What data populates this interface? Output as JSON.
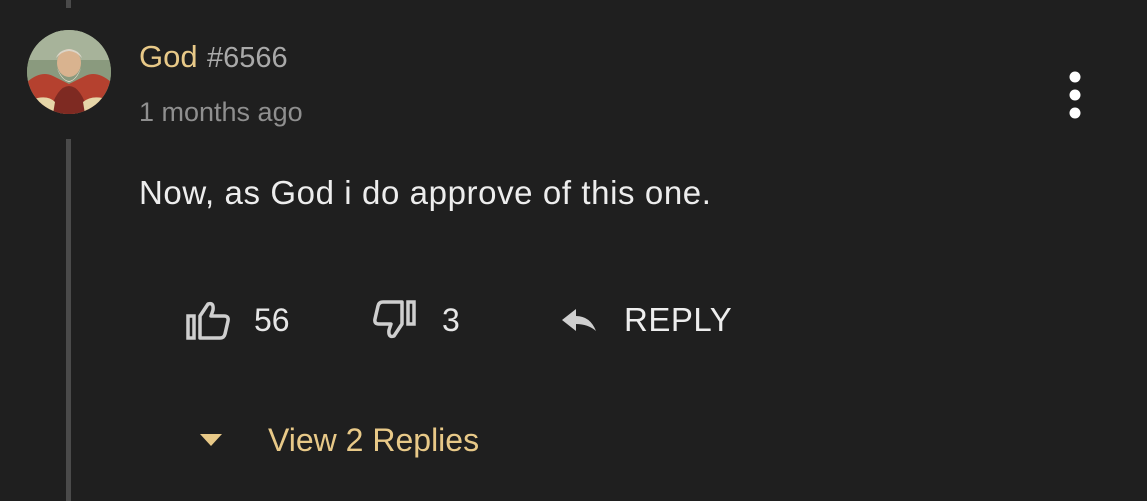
{
  "comment": {
    "author": {
      "name": "God",
      "tag": "#6566"
    },
    "timestamp": "1 months ago",
    "text": "Now, as God i do approve of this one.",
    "likes": "56",
    "dislikes": "3",
    "reply_label": "REPLY",
    "view_replies_label": "View 2 Replies"
  },
  "colors": {
    "background": "#1f1f1f",
    "accent": "#e8c988",
    "text": "#ededed",
    "muted": "#8f8f8f",
    "thread_line": "#4a4a4a"
  },
  "icons": {
    "more": "vertical-dots-icon",
    "like": "thumbs-up-icon",
    "dislike": "thumbs-down-icon",
    "reply": "reply-arrow-icon",
    "expand": "caret-down-icon"
  }
}
